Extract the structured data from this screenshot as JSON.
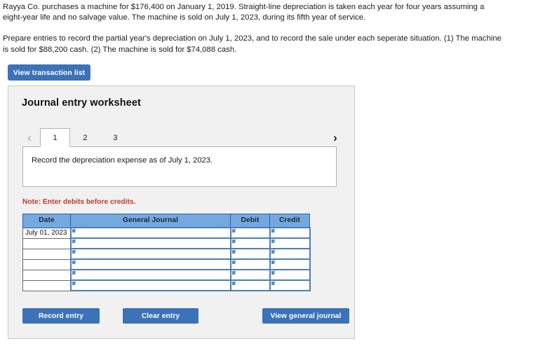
{
  "problem": {
    "paragraph1": "Rayya Co. purchases a machine for $176,400 on January 1, 2019. Straight-line depreciation is taken each year for four years assuming a eight-year life and no salvage value. The machine is sold on July 1, 2023, during its fifth year of service.",
    "paragraph2": "Prepare entries to record the partial year's depreciation on July 1, 2023, and to record the sale under each seperate situation.  (1) The machine is sold for $88,200 cash. (2) The machine is sold for $74,088 cash."
  },
  "toolbar": {
    "view_transaction_list_label": "View transaction list"
  },
  "panel": {
    "title": "Journal entry worksheet",
    "nav": {
      "prev_icon": "chevron-left",
      "prev_glyph": "‹",
      "next_icon": "chevron-right",
      "next_glyph": "›",
      "prev_enabled": false,
      "next_enabled": true
    },
    "tabs": [
      {
        "label": "1",
        "active": true
      },
      {
        "label": "2",
        "active": false
      },
      {
        "label": "3",
        "active": false
      }
    ],
    "instruction": "Record the depreciation expense as of July 1, 2023.",
    "note": "Note: Enter debits before credits.",
    "table": {
      "headers": [
        "Date",
        "General Journal",
        "Debit",
        "Credit"
      ],
      "rows": [
        {
          "date": "July 01, 2023",
          "general_journal": "",
          "debit": "",
          "credit": ""
        },
        {
          "date": "",
          "general_journal": "",
          "debit": "",
          "credit": ""
        },
        {
          "date": "",
          "general_journal": "",
          "debit": "",
          "credit": ""
        },
        {
          "date": "",
          "general_journal": "",
          "debit": "",
          "credit": ""
        },
        {
          "date": "",
          "general_journal": "",
          "debit": "",
          "credit": ""
        },
        {
          "date": "",
          "general_journal": "",
          "debit": "",
          "credit": ""
        }
      ]
    },
    "buttons": {
      "record_entry": "Record entry",
      "clear_entry": "Clear entry",
      "view_general_journal": "View general journal"
    }
  },
  "colors": {
    "button_blue": "#3c72b8",
    "table_header_blue": "#75a8de",
    "input_border_blue": "#4a7ebb",
    "note_red": "#c0392b",
    "panel_gray": "#f1f1f1"
  }
}
